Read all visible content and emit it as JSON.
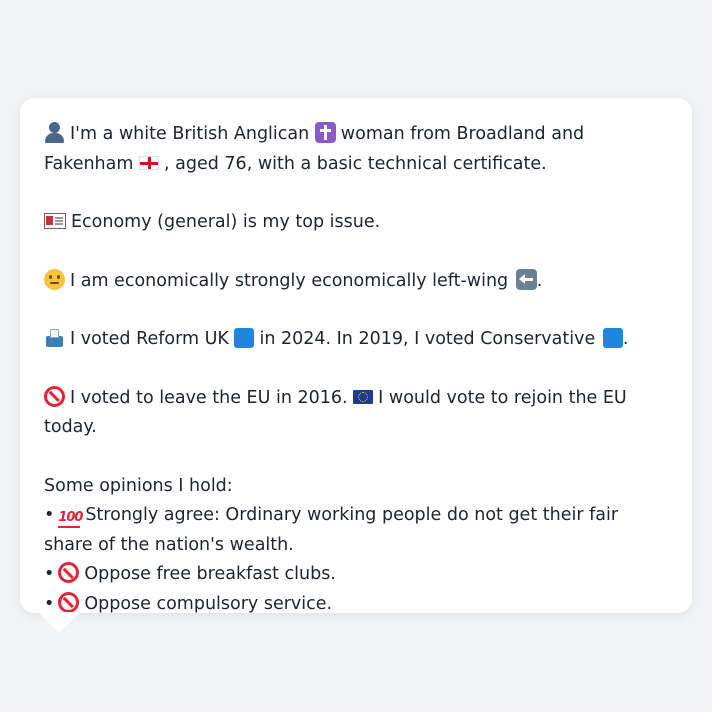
{
  "line1": {
    "part1": "I'm a white British Anglican",
    "part2": "woman from Broadland and Fakenham",
    "part3": ",",
    "part4": "aged 76, with a basic technical certificate."
  },
  "line2": "Economy (general) is my top issue.",
  "line3": {
    "text": "I am economically strongly economically left-wing",
    "suffix": "."
  },
  "line4": {
    "part1": "I voted Reform UK",
    "part2": "in 2024. In 2019, I voted Conservative",
    "suffix": "."
  },
  "line5": {
    "part1": "I voted to leave the EU in 2016.",
    "part2": "I would vote to rejoin the EU today."
  },
  "opinions": {
    "heading": "Some opinions I hold:",
    "bullet": "•",
    "items": [
      "Strongly agree: Ordinary working people do not get their fair share of the nation's wealth.",
      "Oppose free breakfast clubs.",
      "Oppose compulsory service."
    ],
    "hundred_glyph": "100"
  },
  "icons": {
    "person": "bust-in-silhouette-icon",
    "cross": "latin-cross-icon",
    "england_flag": "flag-england-icon",
    "newspaper": "newspaper-icon",
    "thinking": "thinking-face-icon",
    "left_arrow": "left-arrow-icon",
    "ballot": "ballot-box-icon",
    "blue_square": "blue-square-icon",
    "prohibited": "prohibited-icon",
    "eu_flag": "flag-eu-icon",
    "hundred": "hundred-points-icon"
  },
  "colors": {
    "background": "#f2f3f5",
    "card": "#ffffff",
    "text": "#1e2430",
    "reform_blue": "#1f86e0",
    "prohibited_red": "#e0253b"
  }
}
